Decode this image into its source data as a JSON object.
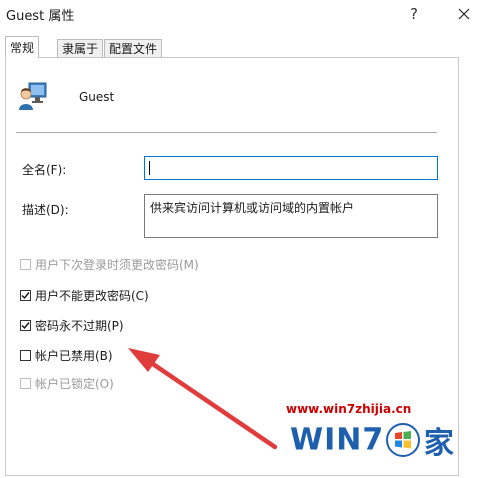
{
  "window": {
    "title": "Guest 属性",
    "help_glyph": "?"
  },
  "tabs": [
    {
      "label": "常规",
      "active": true
    },
    {
      "label": "隶属于",
      "active": false
    },
    {
      "label": "配置文件",
      "active": false
    }
  ],
  "user": {
    "name": "Guest",
    "icon": "user-monitor-icon"
  },
  "fields": {
    "fullname": {
      "label": "全名(F):",
      "value": ""
    },
    "description": {
      "label": "描述(D):",
      "value": "供来宾访问计算机或访问域的内置帐户"
    }
  },
  "checkboxes": [
    {
      "label": "用户下次登录时须更改密码(M)",
      "checked": false,
      "enabled": false
    },
    {
      "label": "用户不能更改密码(C)",
      "checked": true,
      "enabled": true
    },
    {
      "label": "密码永不过期(P)",
      "checked": true,
      "enabled": true
    },
    {
      "label": "帐户已禁用(B)",
      "checked": false,
      "enabled": true
    },
    {
      "label": "帐户已锁定(O)",
      "checked": false,
      "enabled": false
    }
  ],
  "watermark": {
    "url": "www.win7zhijia.cn",
    "logo_text": "WIN7",
    "logo_suffix": "家"
  },
  "colors": {
    "focus_border": "#0078d7",
    "arrow": "#e03c3c",
    "watermark_red": "#cc0000",
    "logo_blue": "#1e5fae"
  }
}
